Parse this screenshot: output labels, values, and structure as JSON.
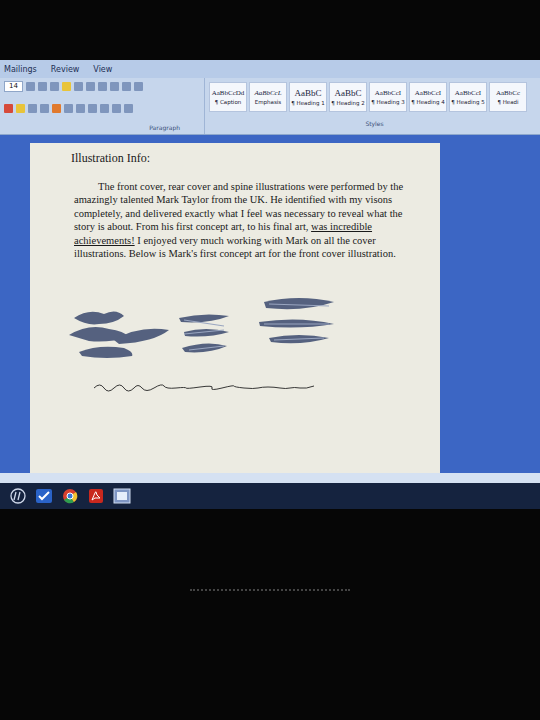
{
  "ribbon": {
    "tabs": [
      {
        "label": "Mailings",
        "selected": false
      },
      {
        "label": "Review",
        "selected": false
      },
      {
        "label": "View",
        "selected": false
      }
    ],
    "font_size": "14",
    "groups": [
      "Paragraph"
    ],
    "styles_group": "Styles",
    "styles": [
      {
        "preview": "AaBbCcDd",
        "label": "¶ Caption",
        "kind": "small"
      },
      {
        "preview": "AaBbCcL",
        "label": "Emphasis",
        "kind": "italic"
      },
      {
        "preview": "AaBbC",
        "label": "¶ Heading 1",
        "kind": "big"
      },
      {
        "preview": "AaBbC",
        "label": "¶ Heading 2",
        "kind": "big"
      },
      {
        "preview": "AaBbCcI",
        "label": "¶ Heading 3",
        "kind": "small"
      },
      {
        "preview": "AaBbCcI",
        "label": "¶ Heading 4",
        "kind": "small"
      },
      {
        "preview": "AaBbCcI",
        "label": "¶ Heading 5",
        "kind": "small"
      },
      {
        "preview": "AaBbCc",
        "label": "¶ Headi",
        "kind": "small"
      }
    ]
  },
  "document": {
    "heading": "Illustration Info:",
    "paragraph": [
      {
        "text": "The front cover, rear cover and spine illustrations were performed by the amazingly talented Mark Taylor from the UK. He identified with my visons completely, and delivered exactly what I feel was necessary to reveal what the story is about. From his first concept art, to his final art, ",
        "underlined": false
      },
      {
        "text": "was incredible achievements!",
        "underlined": true
      },
      {
        "text": " I enjoyed very much working with Mark on all the cover illustrations. Below is Mark's first concept art for the front cover illustration.",
        "underlined": false
      }
    ]
  }
}
